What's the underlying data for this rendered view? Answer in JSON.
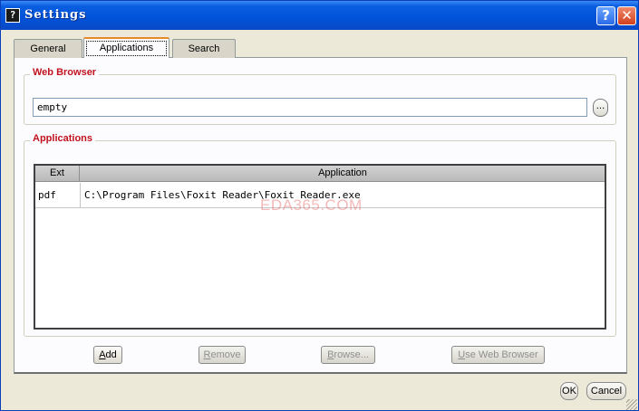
{
  "window": {
    "title": "Settings",
    "title_icon": "?",
    "help_glyph": "?",
    "close_glyph": "✕"
  },
  "tabs": [
    {
      "label": "General"
    },
    {
      "label": "Applications",
      "selected": true
    },
    {
      "label": "Search"
    }
  ],
  "web_browser": {
    "group_label": "Web Browser",
    "value": "empty",
    "browse_label": "..."
  },
  "applications": {
    "group_label": "Applications",
    "columns": [
      "Ext",
      "Application"
    ],
    "rows": [
      {
        "ext": "pdf",
        "application": "C:\\Program Files\\Foxit Reader\\Foxit Reader.exe"
      }
    ]
  },
  "watermark": "EDA365.COM",
  "buttons": {
    "add": {
      "mnemonic": "A",
      "rest": "dd"
    },
    "remove": {
      "mnemonic": "R",
      "rest": "emove"
    },
    "browse": {
      "mnemonic": "B",
      "rest": "rowse..."
    },
    "use_web_browser": {
      "mnemonic": "U",
      "rest": "se Web Browser"
    },
    "ok": "OK",
    "cancel": "Cancel"
  },
  "colors": {
    "titlebar": "#0053d8",
    "group_label": "#c1121f",
    "selected_tab_accent": "#e68b2c"
  }
}
